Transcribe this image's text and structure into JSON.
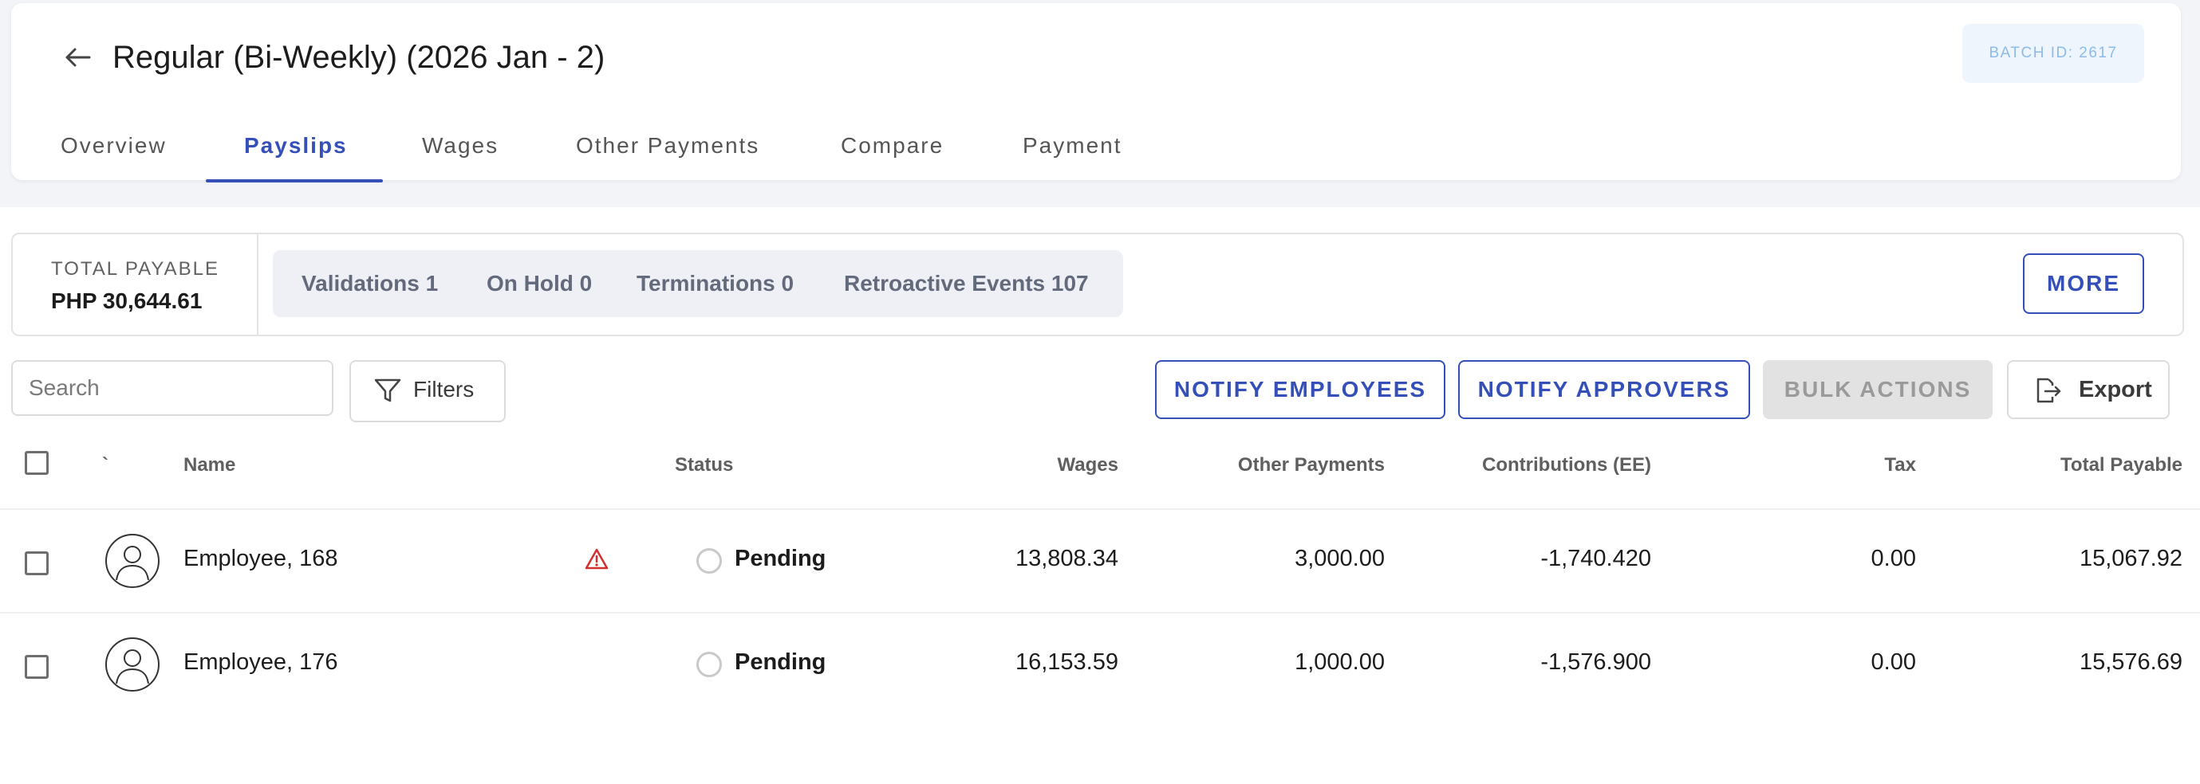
{
  "header": {
    "title": "Regular (Bi-Weekly) (2026 Jan - 2)",
    "batch_id": "BATCH ID: 2617",
    "tabs": [
      {
        "label": "Overview"
      },
      {
        "label": "Payslips"
      },
      {
        "label": "Wages"
      },
      {
        "label": "Other Payments"
      },
      {
        "label": "Compare"
      },
      {
        "label": "Payment"
      }
    ],
    "active_tab": "Payslips"
  },
  "summary": {
    "total_caption": "TOTAL PAYABLE",
    "total_value": "PHP 30,644.61",
    "chips": [
      {
        "label": "Validations 1"
      },
      {
        "label": "On Hold 0"
      },
      {
        "label": "Terminations 0"
      },
      {
        "label": "Retroactive Events 107"
      }
    ],
    "more_label": "MORE"
  },
  "toolbar": {
    "search_placeholder": "Search",
    "filters_label": "Filters",
    "notify_employees": "NOTIFY EMPLOYEES",
    "notify_approvers": "NOTIFY APPROVERS",
    "bulk_actions": "BULK ACTIONS",
    "export_label": "Export"
  },
  "table": {
    "columns": {
      "marker": "`",
      "name": "Name",
      "status": "Status",
      "wages": "Wages",
      "other_payments": "Other Payments",
      "contributions": "Contributions (EE)",
      "tax": "Tax",
      "total_payable": "Total Payable"
    },
    "rows": [
      {
        "name": "Employee, 168",
        "warning": true,
        "status": "Pending",
        "wages": "13,808.34",
        "other_payments": "3,000.00",
        "contributions": "-1,740.420",
        "tax": "0.00",
        "total_payable": "15,067.92"
      },
      {
        "name": "Employee, 176",
        "warning": false,
        "status": "Pending",
        "wages": "16,153.59",
        "other_payments": "1,000.00",
        "contributions": "-1,576.900",
        "tax": "0.00",
        "total_payable": "15,576.69"
      }
    ]
  },
  "colors": {
    "accent": "#3450b8",
    "badge_bg": "#eef5fc",
    "badge_text": "#8cbbe8",
    "warning": "#d32f2f",
    "chip_bg": "#eef0f6"
  }
}
